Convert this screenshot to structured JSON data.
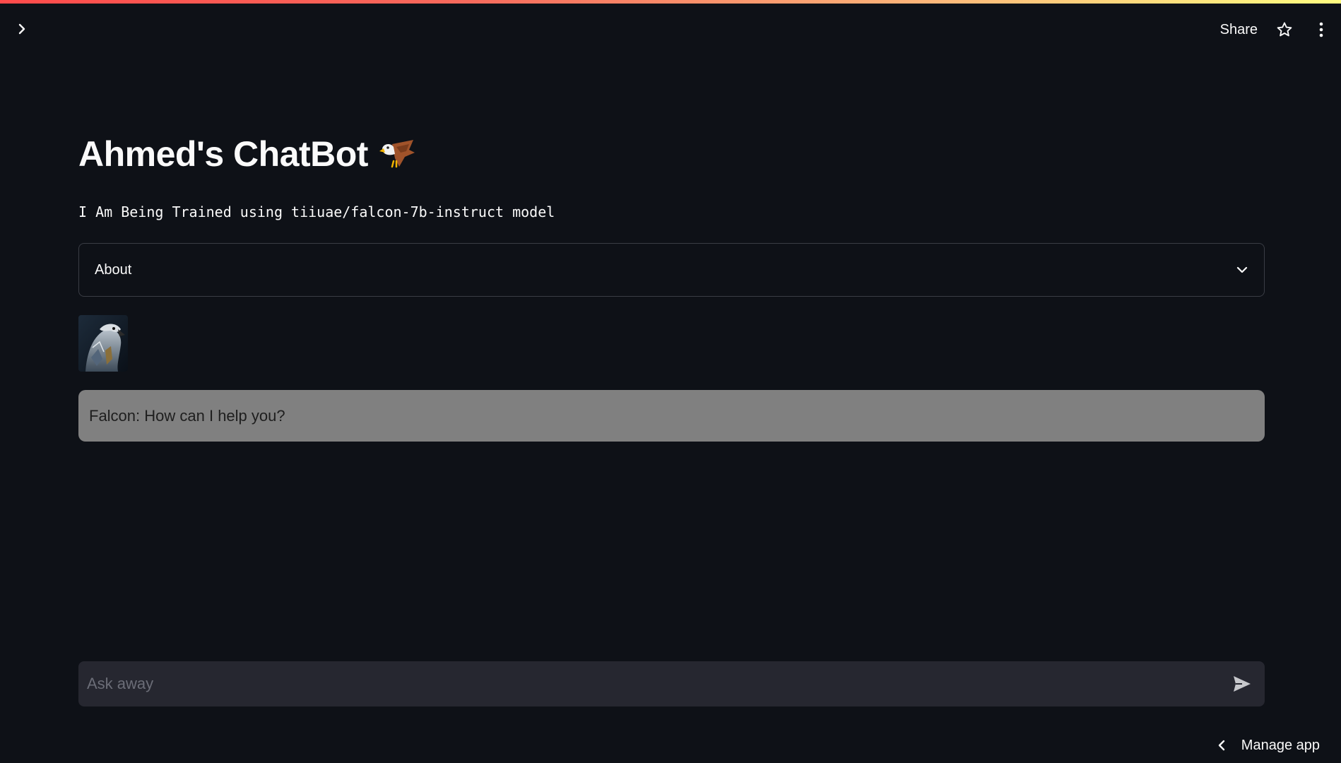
{
  "header": {
    "share_label": "Share",
    "icons": [
      "chevron-right-icon",
      "star-icon",
      "kebab-menu-icon"
    ]
  },
  "main": {
    "title": "Ahmed's ChatBot",
    "title_emoji": "eagle",
    "subtitle": "I Am Being Trained using tiiuae/falcon-7b-instruct model",
    "expander": {
      "label": "About",
      "icon": "chevron-down-icon"
    },
    "avatar_alt": "falcon avatar",
    "messages": [
      {
        "text": "Falcon: How can I help you?"
      }
    ]
  },
  "chat_input": {
    "placeholder": "Ask away",
    "value": "",
    "send_icon": "send-icon"
  },
  "footer": {
    "manage_label": "Manage app",
    "icon": "chevron-left-icon"
  },
  "colors": {
    "background": "#0e1117",
    "message_bg": "#808080",
    "input_bg": "#262730",
    "border": "#3a3d45"
  }
}
